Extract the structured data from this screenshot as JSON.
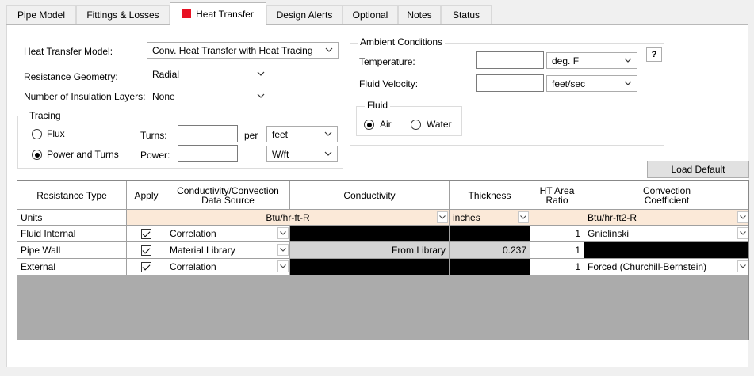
{
  "tabs": [
    {
      "label": "Pipe Model"
    },
    {
      "label": "Fittings & Losses"
    },
    {
      "label": "Heat Transfer"
    },
    {
      "label": "Design Alerts"
    },
    {
      "label": "Optional"
    },
    {
      "label": "Notes"
    },
    {
      "label": "Status"
    }
  ],
  "form": {
    "heat_transfer_model_label": "Heat Transfer Model:",
    "heat_transfer_model_value": "Conv. Heat Transfer with Heat Tracing",
    "resistance_geometry_label": "Resistance Geometry:",
    "resistance_geometry_value": "Radial",
    "insulation_layers_label": "Number of Insulation Layers:",
    "insulation_layers_value": "None"
  },
  "tracing": {
    "title": "Tracing",
    "flux_label": "Flux",
    "power_turns_label": "Power and Turns",
    "selected": "Power and Turns",
    "turns_label": "Turns:",
    "turns_value": "",
    "per_label": "per",
    "per_unit": "feet",
    "power_label": "Power:",
    "power_value": "",
    "power_unit": "W/ft"
  },
  "ambient": {
    "title": "Ambient Conditions",
    "temperature_label": "Temperature:",
    "temperature_value": "",
    "temperature_unit": "deg. F",
    "velocity_label": "Fluid Velocity:",
    "velocity_value": "",
    "velocity_unit": "feet/sec",
    "help_label": "?",
    "fluid_title": "Fluid",
    "air_label": "Air",
    "water_label": "Water",
    "fluid_selected": "Air"
  },
  "load_default_label": "Load Default",
  "table": {
    "headers": {
      "resistance_type": "Resistance Type",
      "apply": "Apply",
      "data_source": "Conductivity/Convection Data Source",
      "conductivity": "Conductivity",
      "thickness": "Thickness",
      "ht_area_ratio": "HT Area Ratio",
      "convection_coefficient": "Convection Coefficient"
    },
    "units": {
      "label": "Units",
      "conductivity": "Btu/hr-ft-R",
      "thickness": "inches",
      "convection": "Btu/hr-ft2-R"
    },
    "rows": [
      {
        "type": "Fluid Internal",
        "apply": true,
        "source": "Correlation",
        "conductivity": "",
        "thickness": "",
        "ratio": "1",
        "convection": "Gnielinski"
      },
      {
        "type": "Pipe Wall",
        "apply": true,
        "source": "Material Library",
        "conductivity": "From Library",
        "thickness": "0.237",
        "ratio": "1",
        "convection": ""
      },
      {
        "type": "External",
        "apply": true,
        "source": "Correlation",
        "conductivity": "",
        "thickness": "",
        "ratio": "1",
        "convection": "Forced (Churchill-Bernstein)"
      }
    ]
  },
  "colors": {
    "accent_red": "#e81123",
    "units_row": "#fbe9d8",
    "grid_empty": "#ababab"
  }
}
